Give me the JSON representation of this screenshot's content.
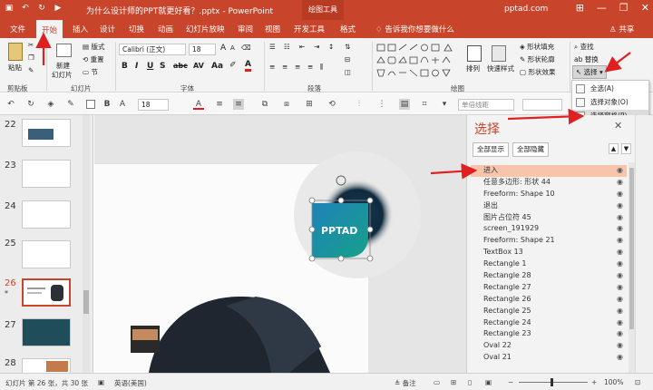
{
  "window": {
    "doc_title": "为什么设计师的PPT就更好看？.pptx  -  PowerPoint",
    "context_tab": "绘图工具",
    "account": "pptad.com",
    "minimize": "—",
    "restore": "❐",
    "close": "✕"
  },
  "tabs": [
    "文件",
    "开始",
    "插入",
    "设计",
    "切换",
    "动画",
    "幻灯片放映",
    "审阅",
    "视图",
    "开发工具",
    "格式"
  ],
  "tell_me": "告诉我你想要做什么",
  "share": "共享",
  "ribbon": {
    "clipboard": {
      "paste": "粘贴",
      "label": "剪贴板"
    },
    "slides": {
      "new_slide": "新建",
      "new_slide2": "幻灯片",
      "layout": "版式",
      "reset": "重置",
      "section": "节",
      "label": "幻灯片"
    },
    "font": {
      "name": "Calibri (正文)",
      "size": "18",
      "label": "字体"
    },
    "paragraph": {
      "label": "段落"
    },
    "drawing": {
      "arrange": "排列",
      "quick_styles": "快速样式",
      "fill": "形状填充",
      "outline": "形状轮廓",
      "effects": "形状效果",
      "label": "绘图"
    },
    "editing": {
      "find": "查找",
      "replace": "替换",
      "select": "选择"
    }
  },
  "select_menu": {
    "items": [
      {
        "label": "全选(A)"
      },
      {
        "label": "选择对象(O)"
      },
      {
        "label": "选择窗格(P)..."
      }
    ]
  },
  "toolbar2": {
    "font_size": "18",
    "style_box": "单倍线距"
  },
  "thumbnails": [
    {
      "num": "22"
    },
    {
      "num": "23"
    },
    {
      "num": "24"
    },
    {
      "num": "25"
    },
    {
      "num": "26",
      "marker": "*",
      "selected": true
    },
    {
      "num": "27"
    },
    {
      "num": "28"
    }
  ],
  "slide": {
    "logo_text": "PPTAD"
  },
  "selection_pane": {
    "title": "选择",
    "show_all": "全部显示",
    "hide_all": "全部隐藏",
    "close_icon": "✕",
    "items": [
      "进入",
      "任意多边形: 形状 44",
      "Freeform: Shape 10",
      "退出",
      "图片占位符 45",
      "screen_191929",
      "Freeform: Shape 21",
      "TextBox 13",
      "Rectangle 1",
      "Rectangle 28",
      "Rectangle 27",
      "Rectangle 26",
      "Rectangle 25",
      "Rectangle 24",
      "Rectangle 23",
      "Oval 22",
      "Oval 21"
    ],
    "active_index": 0
  },
  "status": {
    "slide_info": "幻灯片 第 26 张，共 30 张",
    "language": "英语(美国)",
    "notes": "备注",
    "zoom": "100%"
  },
  "colors": {
    "accent": "#c8442b",
    "highlight_row": "#f8c5ac",
    "logo_gradient_start": "#1e82b8",
    "logo_gradient_end": "#17a08a"
  }
}
